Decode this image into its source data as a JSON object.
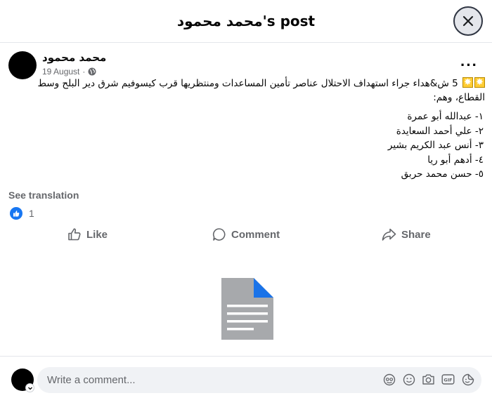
{
  "header": {
    "title": "محمد محمود's post",
    "close_icon": "close-icon"
  },
  "post": {
    "author": "محمد محمود",
    "date": "19 August",
    "audience_icon": "globe-icon",
    "more_icon": "more-icon",
    "text": "5 ش&هداء جراء استهداف الاحتلال عناصر تأمين المساعدات ومنتظريها قرب كيسوفيم شرق دير البلح وسط القطاع، وهم:",
    "list": [
      "١- عبدالله أبو عمرة",
      "٢- علي أحمد السعايدة",
      "٣-  أنس عبد الكريم بشير",
      "٤-  أدهم أبو ريا",
      "٥- حسن محمد حربق"
    ],
    "see_translation": "See translation",
    "reaction_count": "1"
  },
  "actions": {
    "like": "Like",
    "comment": "Comment",
    "share": "Share"
  },
  "attachment": {
    "icon": "document-icon"
  },
  "composer": {
    "placeholder": "Write a comment...",
    "icons": [
      "avatar-sticker-icon",
      "emoji-icon",
      "camera-icon",
      "gif-icon",
      "sticker-icon"
    ]
  },
  "colors": {
    "brand": "#1877f2",
    "secondary_text": "#65676b",
    "input_bg": "#f0f2f5",
    "document_gray": "#a7a9ac",
    "document_fold": "#1a73e8"
  }
}
